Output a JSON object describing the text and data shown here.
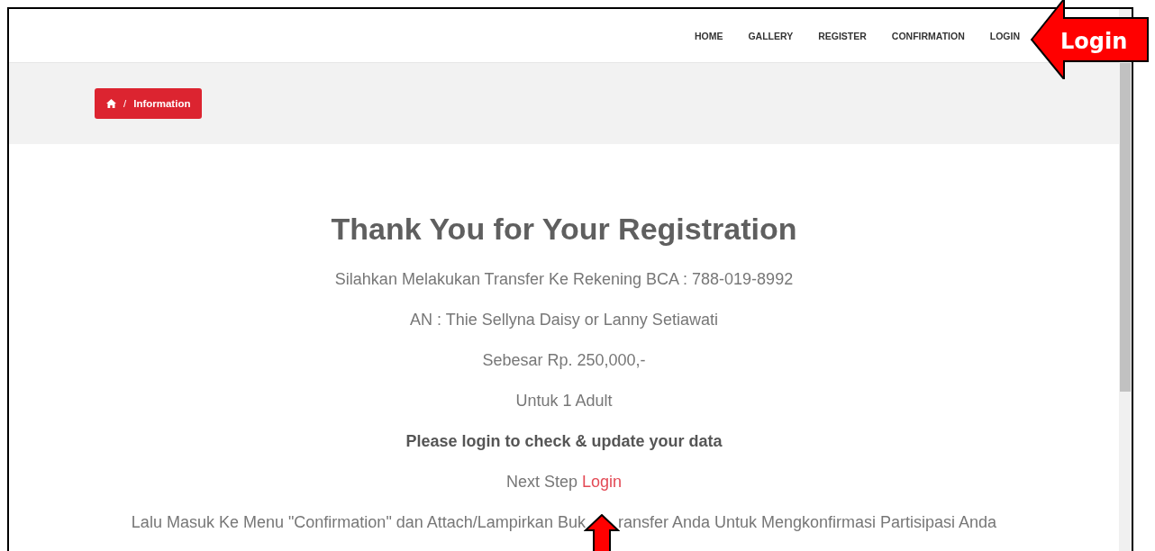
{
  "nav": [
    {
      "label": "HOME"
    },
    {
      "label": "GALLERY"
    },
    {
      "label": "REGISTER"
    },
    {
      "label": "CONFIRMATION"
    },
    {
      "label": "LOGIN"
    }
  ],
  "callout": {
    "label": "Login"
  },
  "breadcrumb": {
    "separator": "/",
    "label": "Information"
  },
  "title": "Thank You for Your Registration",
  "lines": [
    {
      "kind": "plain",
      "text": "Silahkan Melakukan Transfer Ke Rekening BCA : 788-019-8992"
    },
    {
      "kind": "plain",
      "text": "AN : Thie Sellyna Daisy or Lanny Setiawati"
    },
    {
      "kind": "plain",
      "text": "Sebesar Rp. 250,000,-"
    },
    {
      "kind": "plain",
      "text": "Untuk 1 Adult"
    },
    {
      "kind": "bold",
      "text": "Please login to check & update your data"
    },
    {
      "kind": "link",
      "text": "Next Step",
      "link": "Login"
    }
  ],
  "instruction": {
    "before": "Lalu Masuk Ke Menu \"Confirmation\" dan Attach/Lampirkan Buk",
    "after": "ransfer Anda Untuk Mengkonfirmasi Partisipasi Anda"
  }
}
